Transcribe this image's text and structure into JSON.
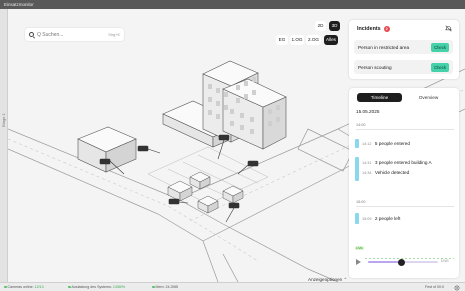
{
  "window": {
    "title": "Einsatzmonitor"
  },
  "left_edge": {
    "label": "Etage 1"
  },
  "search": {
    "placeholder": "Q Suchen...",
    "shortcut": "Strg+K"
  },
  "view_toggle": {
    "options": [
      "2D",
      "3D"
    ],
    "active": "3D"
  },
  "floors": {
    "options": [
      "EG",
      "1.OG",
      "2.OG",
      "Alles"
    ],
    "active": "Alles"
  },
  "incidents": {
    "title": "Incidents",
    "count": "2",
    "items": [
      {
        "label": "Person in restricted area",
        "action": "Check"
      },
      {
        "label": "Person scouting",
        "action": "Check"
      }
    ]
  },
  "timeline": {
    "tabs": [
      "Timeline",
      "Overview"
    ],
    "active_tab": "Timeline",
    "date": "15.05.2025",
    "hours": [
      "14:00",
      "15:00"
    ],
    "events": [
      {
        "time": "14:12",
        "text": "5 people entered"
      },
      {
        "time": "14:31",
        "text": "3 people entered building A"
      },
      {
        "time": "14:34",
        "text": "Vehicle detected"
      },
      {
        "time": "15:09",
        "text": "2 people left"
      }
    ],
    "live_badge": "LIVE",
    "playback_label": "Live",
    "playback_progress": 0.48
  },
  "map": {
    "display_options": "Anzeigeoptionen"
  },
  "status": {
    "cameras_label": "Cameras online:",
    "cameras_value": "12/13",
    "load_label": "Auslastung des Systems:",
    "load_value": "13/80%",
    "memory": "Mem: 24.2MB",
    "zoom": "Fest of 00:0"
  },
  "colors": {
    "accent_check": "#45d1a9",
    "badge": "#e5484d",
    "timeline_bar": "#8ad8ee"
  },
  "icons": [
    "search-icon",
    "bell-off-icon",
    "play-icon",
    "settings-icon",
    "camera-icon"
  ]
}
